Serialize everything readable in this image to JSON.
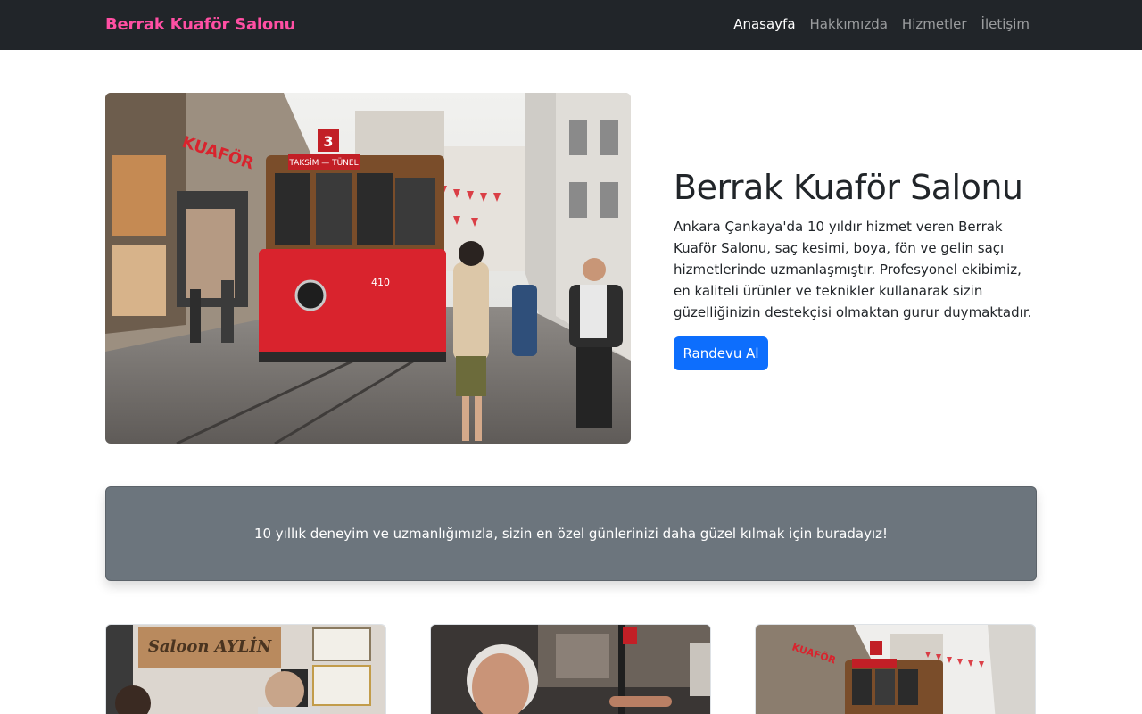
{
  "navbar": {
    "brand": "Berrak Kuaför Salonu",
    "items": [
      {
        "label": "Anasayfa",
        "active": true
      },
      {
        "label": "Hakkımızda",
        "active": false
      },
      {
        "label": "Hizmetler",
        "active": false
      },
      {
        "label": "İletişim",
        "active": false
      }
    ]
  },
  "hero": {
    "title": "Berrak Kuaför Salonu",
    "description": "Ankara Çankaya'da 10 yıldır hizmet veren Berrak Kuaför Salonu, saç kesimi, boya, fön ve gelin saçı hizmetlerinde uzmanlaşmıştır. Profesyonel ekibimiz, en kaliteli ürünler ve teknikler kullanarak sizin güzelliğinizin destekçisi olmaktan gurur duymaktadır.",
    "button_label": "Randevu Al",
    "image_signs": {
      "shop": "KUAFÖR",
      "tram_route": "TAKSİM — TÜNEL",
      "tram_number": "3",
      "tram_id": "410"
    }
  },
  "callout": {
    "text": "10 yıllık deneyim ve uzmanlığımızla, sizin en özel günlerinizi daha güzel kılmak için buradayız!"
  },
  "cards": [
    {
      "image_sign": "Saloon AYLİN"
    },
    {
      "image_sign": ""
    },
    {
      "image_sign": "KUAFÖR"
    }
  ],
  "colors": {
    "navbar_bg": "#212529",
    "brand": "#ff4fa3",
    "primary": "#0d6efd",
    "callout_bg": "#6c757d",
    "tram_red": "#d9232d"
  }
}
